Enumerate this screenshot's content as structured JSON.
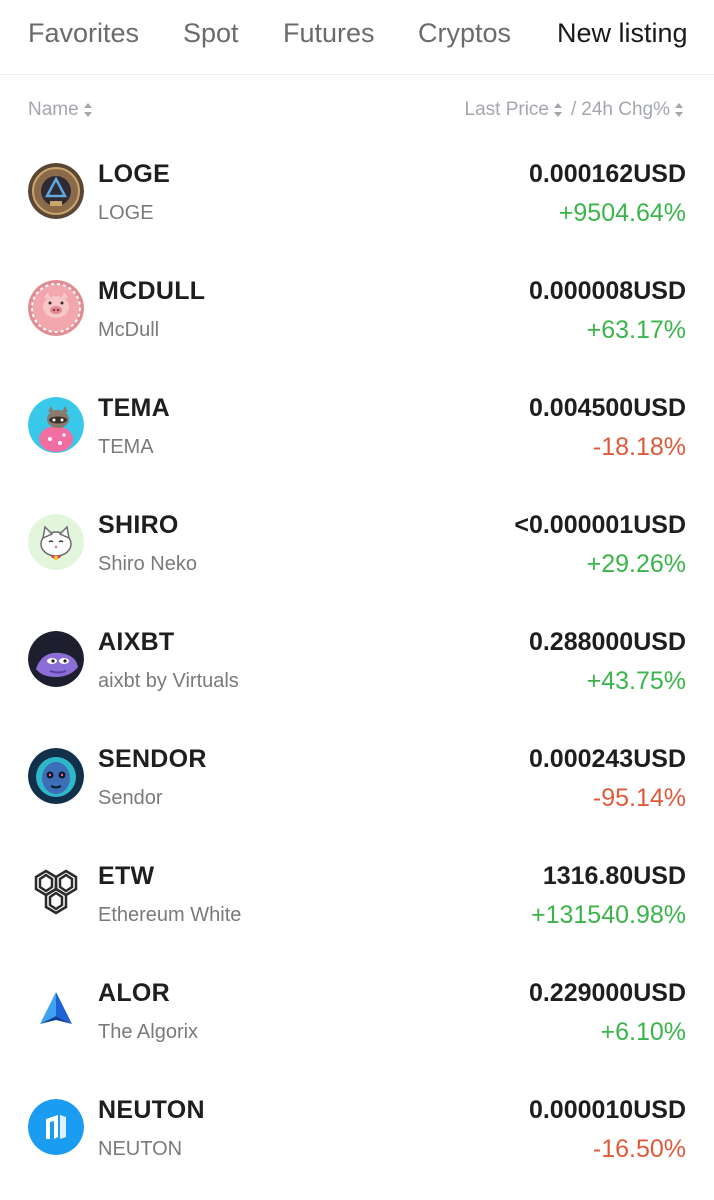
{
  "tabs": [
    "Favorites",
    "Spot",
    "Futures",
    "Cryptos",
    "New listing"
  ],
  "active_tab": "New listing",
  "columns": {
    "name": "Name",
    "last_price": "Last Price",
    "separator": "/",
    "change": "24h Chg%"
  },
  "colors": {
    "up": "#3bb54a",
    "down": "#e0593a",
    "text": "#1e1e1e",
    "muted": "#7a7a7a"
  },
  "rows": [
    {
      "symbol": "LOGE",
      "name": "LOGE",
      "price": "0.000162USD",
      "change": "+9504.64%",
      "direction": "up",
      "icon": "loge-coin-icon"
    },
    {
      "symbol": "MCDULL",
      "name": "McDull",
      "price": "0.000008USD",
      "change": "+63.17%",
      "direction": "up",
      "icon": "pig-icon"
    },
    {
      "symbol": "TEMA",
      "name": "TEMA",
      "price": "0.004500USD",
      "change": "-18.18%",
      "direction": "down",
      "icon": "raccoon-icon"
    },
    {
      "symbol": "SHIRO",
      "name": "Shiro Neko",
      "price": "<0.000001USD",
      "change": "+29.26%",
      "direction": "up",
      "icon": "cat-icon"
    },
    {
      "symbol": "AIXBT",
      "name": "aixbt by Virtuals",
      "price": "0.288000USD",
      "change": "+43.75%",
      "direction": "up",
      "icon": "pepe-icon"
    },
    {
      "symbol": "SENDOR",
      "name": "Sendor",
      "price": "0.000243USD",
      "change": "-95.14%",
      "direction": "down",
      "icon": "sendor-face-icon"
    },
    {
      "symbol": "ETW",
      "name": "Ethereum White",
      "price": "1316.80USD",
      "change": "+131540.98%",
      "direction": "up",
      "icon": "hexagon-cubes-icon"
    },
    {
      "symbol": "ALOR",
      "name": "The Algorix",
      "price": "0.229000USD",
      "change": "+6.10%",
      "direction": "up",
      "icon": "blue-triangle-icon"
    },
    {
      "symbol": "NEUTON",
      "name": "NEUTON",
      "price": "0.000010USD",
      "change": "-16.50%",
      "direction": "down",
      "icon": "neuton-n-icon"
    }
  ]
}
